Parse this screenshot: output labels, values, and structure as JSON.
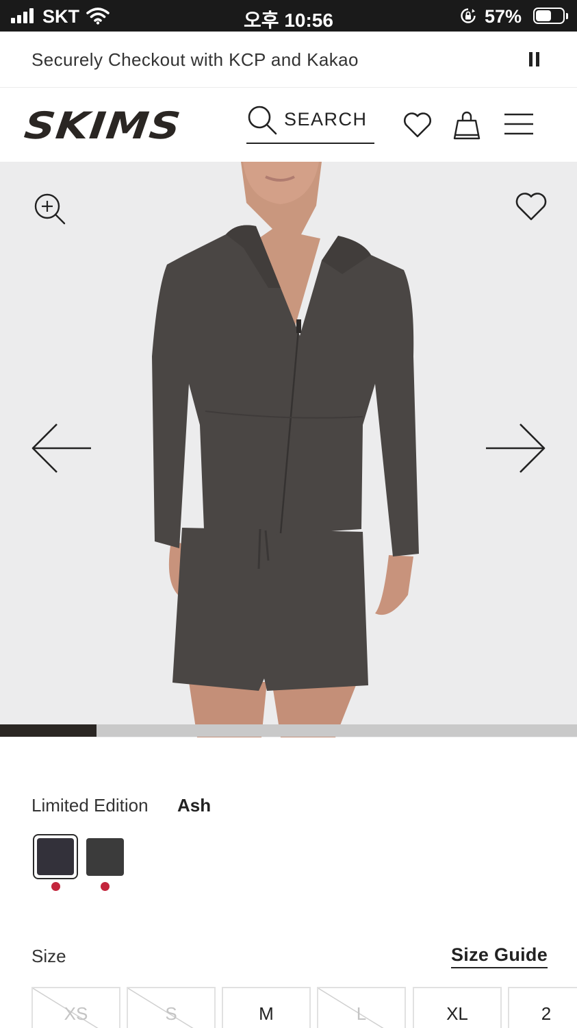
{
  "status_bar": {
    "carrier": "SKT",
    "time": "오후 10:56",
    "battery_percent": "57%",
    "battery_level": 0.57
  },
  "announcement": {
    "text": "Securely Checkout with KCP and Kakao",
    "pause_icon": "pause-icon"
  },
  "header": {
    "logo": "SKIMS",
    "search_label": "SEARCH",
    "icons": [
      "search-icon",
      "heart-icon",
      "shopping-bag-icon",
      "hamburger-menu-icon"
    ]
  },
  "gallery": {
    "icons": [
      "zoom-in-icon",
      "heart-icon",
      "arrow-left-icon",
      "arrow-right-icon"
    ],
    "progress_fraction": 0.167,
    "image_description_colors": {
      "background": "#ececed",
      "garment": "#4a4644"
    }
  },
  "color_section": {
    "label": "Limited Edition",
    "selected_color": "Ash",
    "swatches": [
      {
        "color": "#33313a",
        "selected": true,
        "dot_color": "#c3253c"
      },
      {
        "color": "#3b3b3b",
        "selected": false,
        "dot_color": "#c3253c"
      }
    ]
  },
  "size_section": {
    "label": "Size",
    "guide_label": "Size Guide",
    "sizes": [
      {
        "label": "XS",
        "available": false
      },
      {
        "label": "S",
        "available": false
      },
      {
        "label": "M",
        "available": true
      },
      {
        "label": "L",
        "available": false
      },
      {
        "label": "XL",
        "available": true
      },
      {
        "label": "2",
        "available": true
      }
    ]
  }
}
